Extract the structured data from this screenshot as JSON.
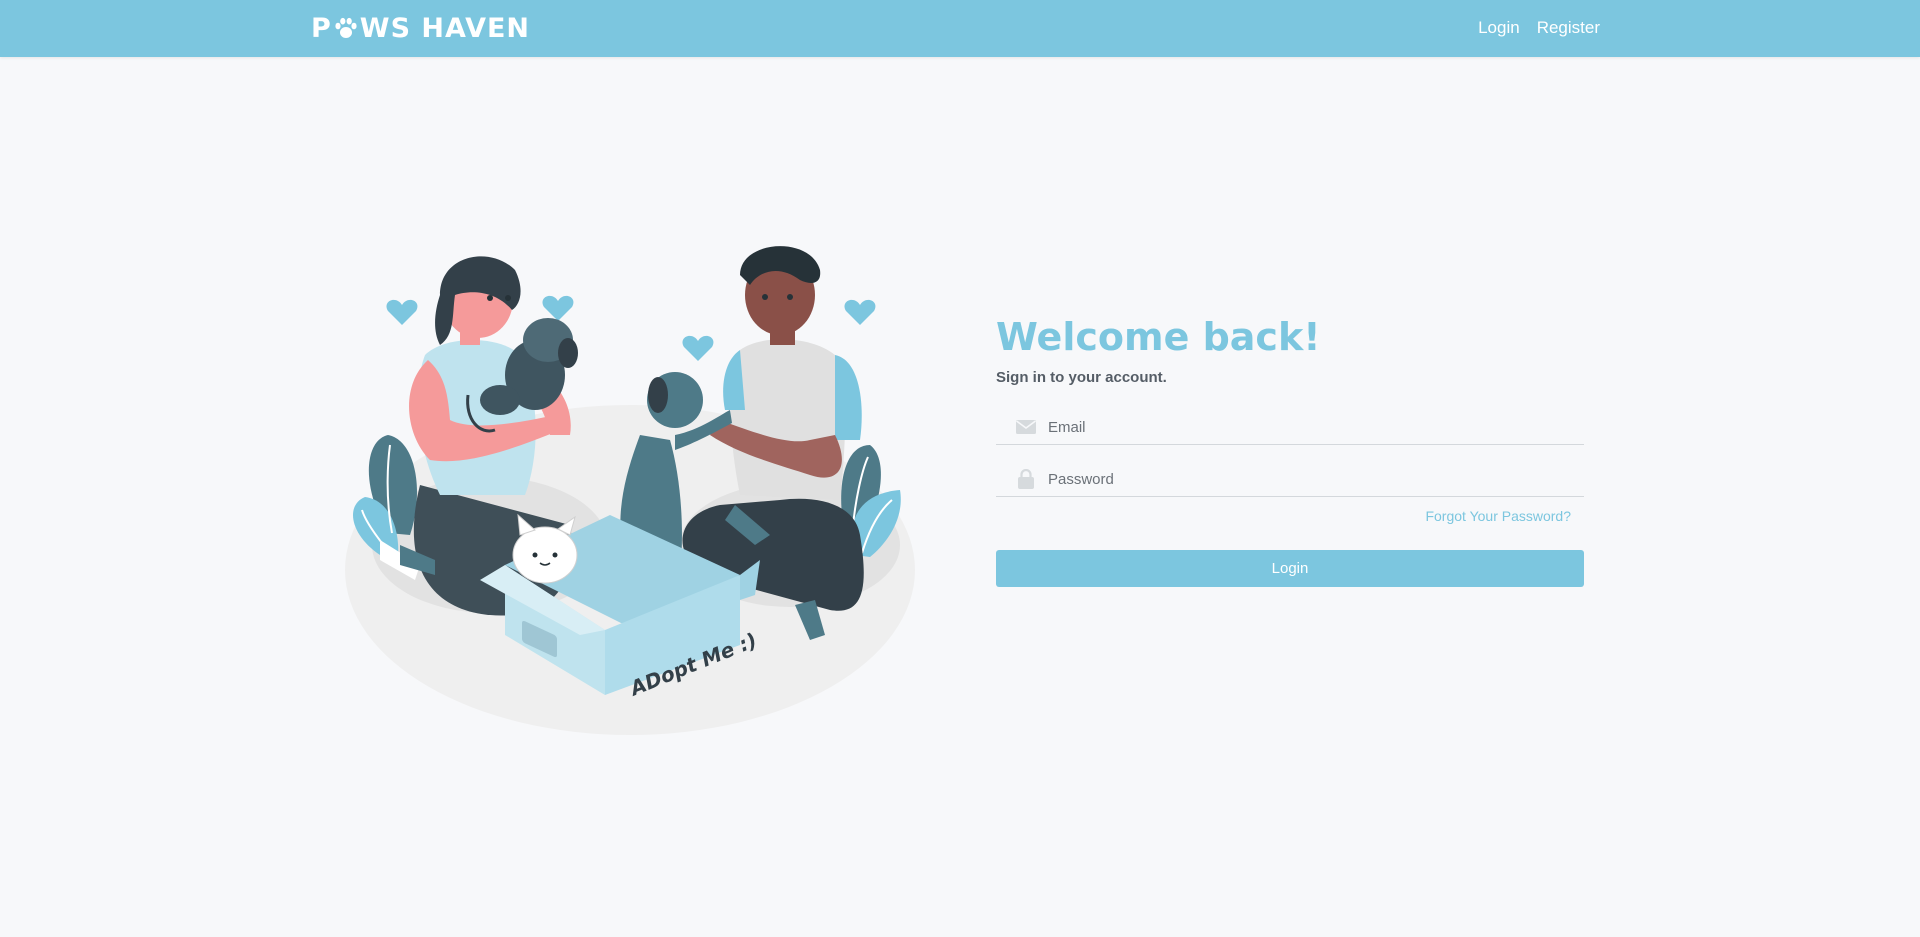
{
  "navbar": {
    "brand": "PAWS HAVEN",
    "brand_left": "P",
    "brand_right": "WS HAVEN",
    "links": [
      {
        "label": "Login"
      },
      {
        "label": "Register"
      }
    ]
  },
  "illustration": {
    "box_text": "ADopt Me :)"
  },
  "login": {
    "title": "Welcome back!",
    "subtitle": "Sign in to your account.",
    "email_placeholder": "Email",
    "password_placeholder": "Password",
    "forgot_label": "Forgot Your Password?",
    "button_label": "Login"
  },
  "colors": {
    "primary": "#7cc6df",
    "background": "#f7f8fa",
    "text_dark": "#555d66"
  },
  "icons": {
    "brand_o": "paw-icon",
    "email": "envelope-icon",
    "password": "lock-icon"
  }
}
